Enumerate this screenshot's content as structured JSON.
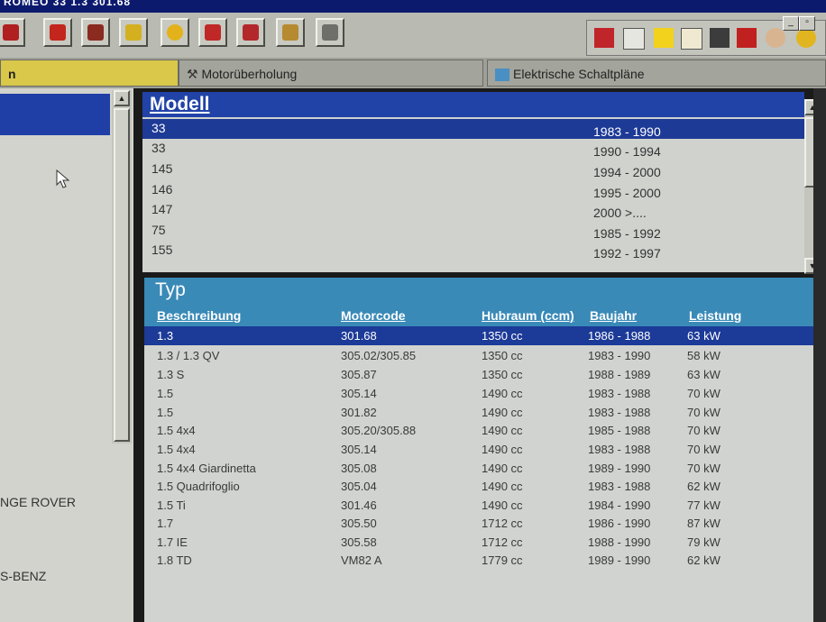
{
  "titlebar": {
    "text": "ROMEO 33 1.3 301.68"
  },
  "window_controls": {
    "minimize": "_",
    "restore": "▫"
  },
  "tabs": [
    {
      "label": "n"
    },
    {
      "label": "Motorüberholung"
    },
    {
      "label": "Elektrische Schaltpläne"
    }
  ],
  "left_pane": {
    "items": [
      "NGE ROVER",
      "S-BENZ"
    ]
  },
  "modell": {
    "title": "Modell",
    "rows": [
      {
        "name": "33",
        "years": "1983 - 1990"
      },
      {
        "name": "33",
        "years": "1990 - 1994"
      },
      {
        "name": "145",
        "years": "1994 - 2000"
      },
      {
        "name": "146",
        "years": "1995 - 2000"
      },
      {
        "name": "147",
        "years": "2000 >...."
      },
      {
        "name": "75",
        "years": "1985 - 1992"
      },
      {
        "name": "155",
        "years": "1992 - 1997"
      }
    ]
  },
  "typ": {
    "title": "Typ",
    "columns": [
      "Beschreibung",
      "Motorcode",
      "Hubraum (ccm)",
      "Baujahr",
      "Leistung"
    ],
    "rows": [
      [
        "1.3",
        "301.68",
        "1350 cc",
        "1986 - 1988",
        "63 kW"
      ],
      [
        "1.3 / 1.3 QV",
        "305.02/305.85",
        "1350 cc",
        "1983 - 1990",
        "58 kW"
      ],
      [
        "1.3 S",
        "305.87",
        "1350 cc",
        "1988 - 1989",
        "63 kW"
      ],
      [
        "1.5",
        "305.14",
        "1490 cc",
        "1983 - 1988",
        "70 kW"
      ],
      [
        "1.5",
        "301.82",
        "1490 cc",
        "1983 - 1988",
        "70 kW"
      ],
      [
        "1.5 4x4",
        "305.20/305.88",
        "1490 cc",
        "1985 - 1988",
        "70 kW"
      ],
      [
        "1.5 4x4",
        "305.14",
        "1490 cc",
        "1983 - 1988",
        "70 kW"
      ],
      [
        "1.5 4x4 Giardinetta",
        "305.08",
        "1490 cc",
        "1989 - 1990",
        "70 kW"
      ],
      [
        "1.5 Quadrifoglio",
        "305.04",
        "1490 cc",
        "1983 - 1988",
        "62 kW"
      ],
      [
        "1.5 Ti",
        "301.46",
        "1490 cc",
        "1984 - 1990",
        "77 kW"
      ],
      [
        "1.7",
        "305.50",
        "1712 cc",
        "1986 - 1990",
        "87 kW"
      ],
      [
        "1.7 IE",
        "305.58",
        "1712 cc",
        "1988 - 1990",
        "79 kW"
      ],
      [
        "1.8 TD",
        "VM82 A",
        "1779 cc",
        "1989 - 1990",
        "62 kW"
      ]
    ]
  },
  "toolbar_icons": [
    "caliper-icon",
    "car-lift-icon",
    "engine-icon",
    "pencil-icon",
    "clock-icon",
    "car-icon",
    "transmission-icon",
    "gears-icon",
    "diagnostic-icon"
  ],
  "right_icons": [
    "car-service-icon",
    "link-icon",
    "info-icon",
    "documents-icon",
    "manual-icon",
    "notes-icon",
    "mechanic-icon",
    "help-icon"
  ],
  "colors": {
    "selection": "#1d3a96",
    "modell_header": "#2143a8",
    "typ_header": "#3a8ab7"
  }
}
